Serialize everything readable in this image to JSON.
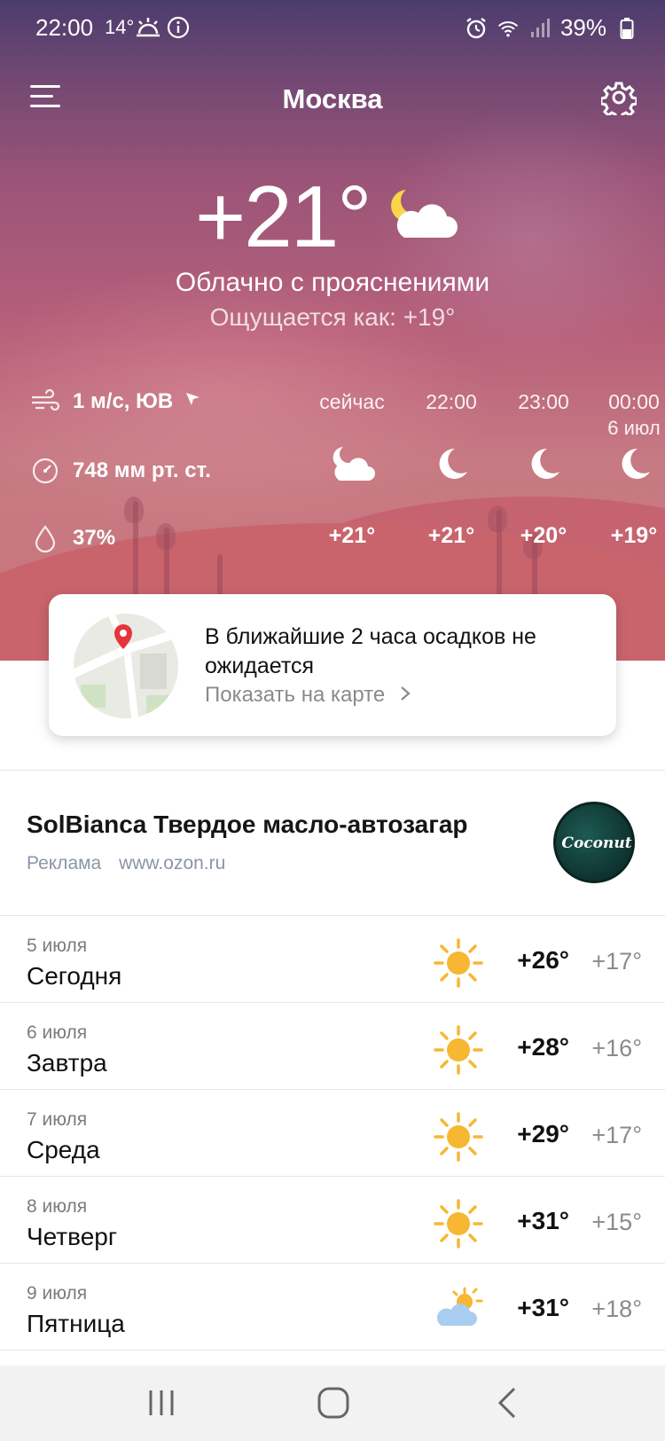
{
  "status_bar": {
    "time": "22:00",
    "weather_temp": "14°",
    "battery": "39%"
  },
  "header": {
    "city": "Москва"
  },
  "current": {
    "temperature": "+21°",
    "condition": "Облачно с прояснениями",
    "feels_like": "Ощущается как: +19°"
  },
  "details": {
    "wind": "1 м/с, ЮВ",
    "pressure": "748 мм рт. ст.",
    "humidity": "37%"
  },
  "hourly": [
    {
      "label": "сейчас",
      "sub": "",
      "icon": "moon-cloud-icon",
      "temp": "+21°"
    },
    {
      "label": "22:00",
      "sub": "",
      "icon": "moon-icon",
      "temp": "+21°"
    },
    {
      "label": "23:00",
      "sub": "",
      "icon": "moon-icon",
      "temp": "+20°"
    },
    {
      "label": "00:00",
      "sub": "6 июл",
      "icon": "moon-icon",
      "temp": "+19°"
    }
  ],
  "precip_card": {
    "text": "В ближайшие 2 часа осадков не ожидается",
    "link": "Показать на карте"
  },
  "ad": {
    "title": "SolBianca Твердое масло-автозагар",
    "label": "Реклама",
    "domain": "www.ozon.ru",
    "image_text": "Coconut"
  },
  "daily": [
    {
      "date": "5 июля",
      "name": "Сегодня",
      "icon": "sun-icon",
      "high": "+26°",
      "low": "+17°"
    },
    {
      "date": "6 июля",
      "name": "Завтра",
      "icon": "sun-icon",
      "high": "+28°",
      "low": "+16°"
    },
    {
      "date": "7 июля",
      "name": "Среда",
      "icon": "sun-icon",
      "high": "+29°",
      "low": "+17°"
    },
    {
      "date": "8 июля",
      "name": "Четверг",
      "icon": "sun-icon",
      "high": "+31°",
      "low": "+15°"
    },
    {
      "date": "9 июля",
      "name": "Пятница",
      "icon": "sun-cloud-icon",
      "high": "+31°",
      "low": "+18°"
    }
  ],
  "colors": {
    "hero_top": "#4a3c6e",
    "hero_bottom": "#c9747a",
    "sun": "#f7b733",
    "cloud_blue": "#a9cdf0"
  }
}
